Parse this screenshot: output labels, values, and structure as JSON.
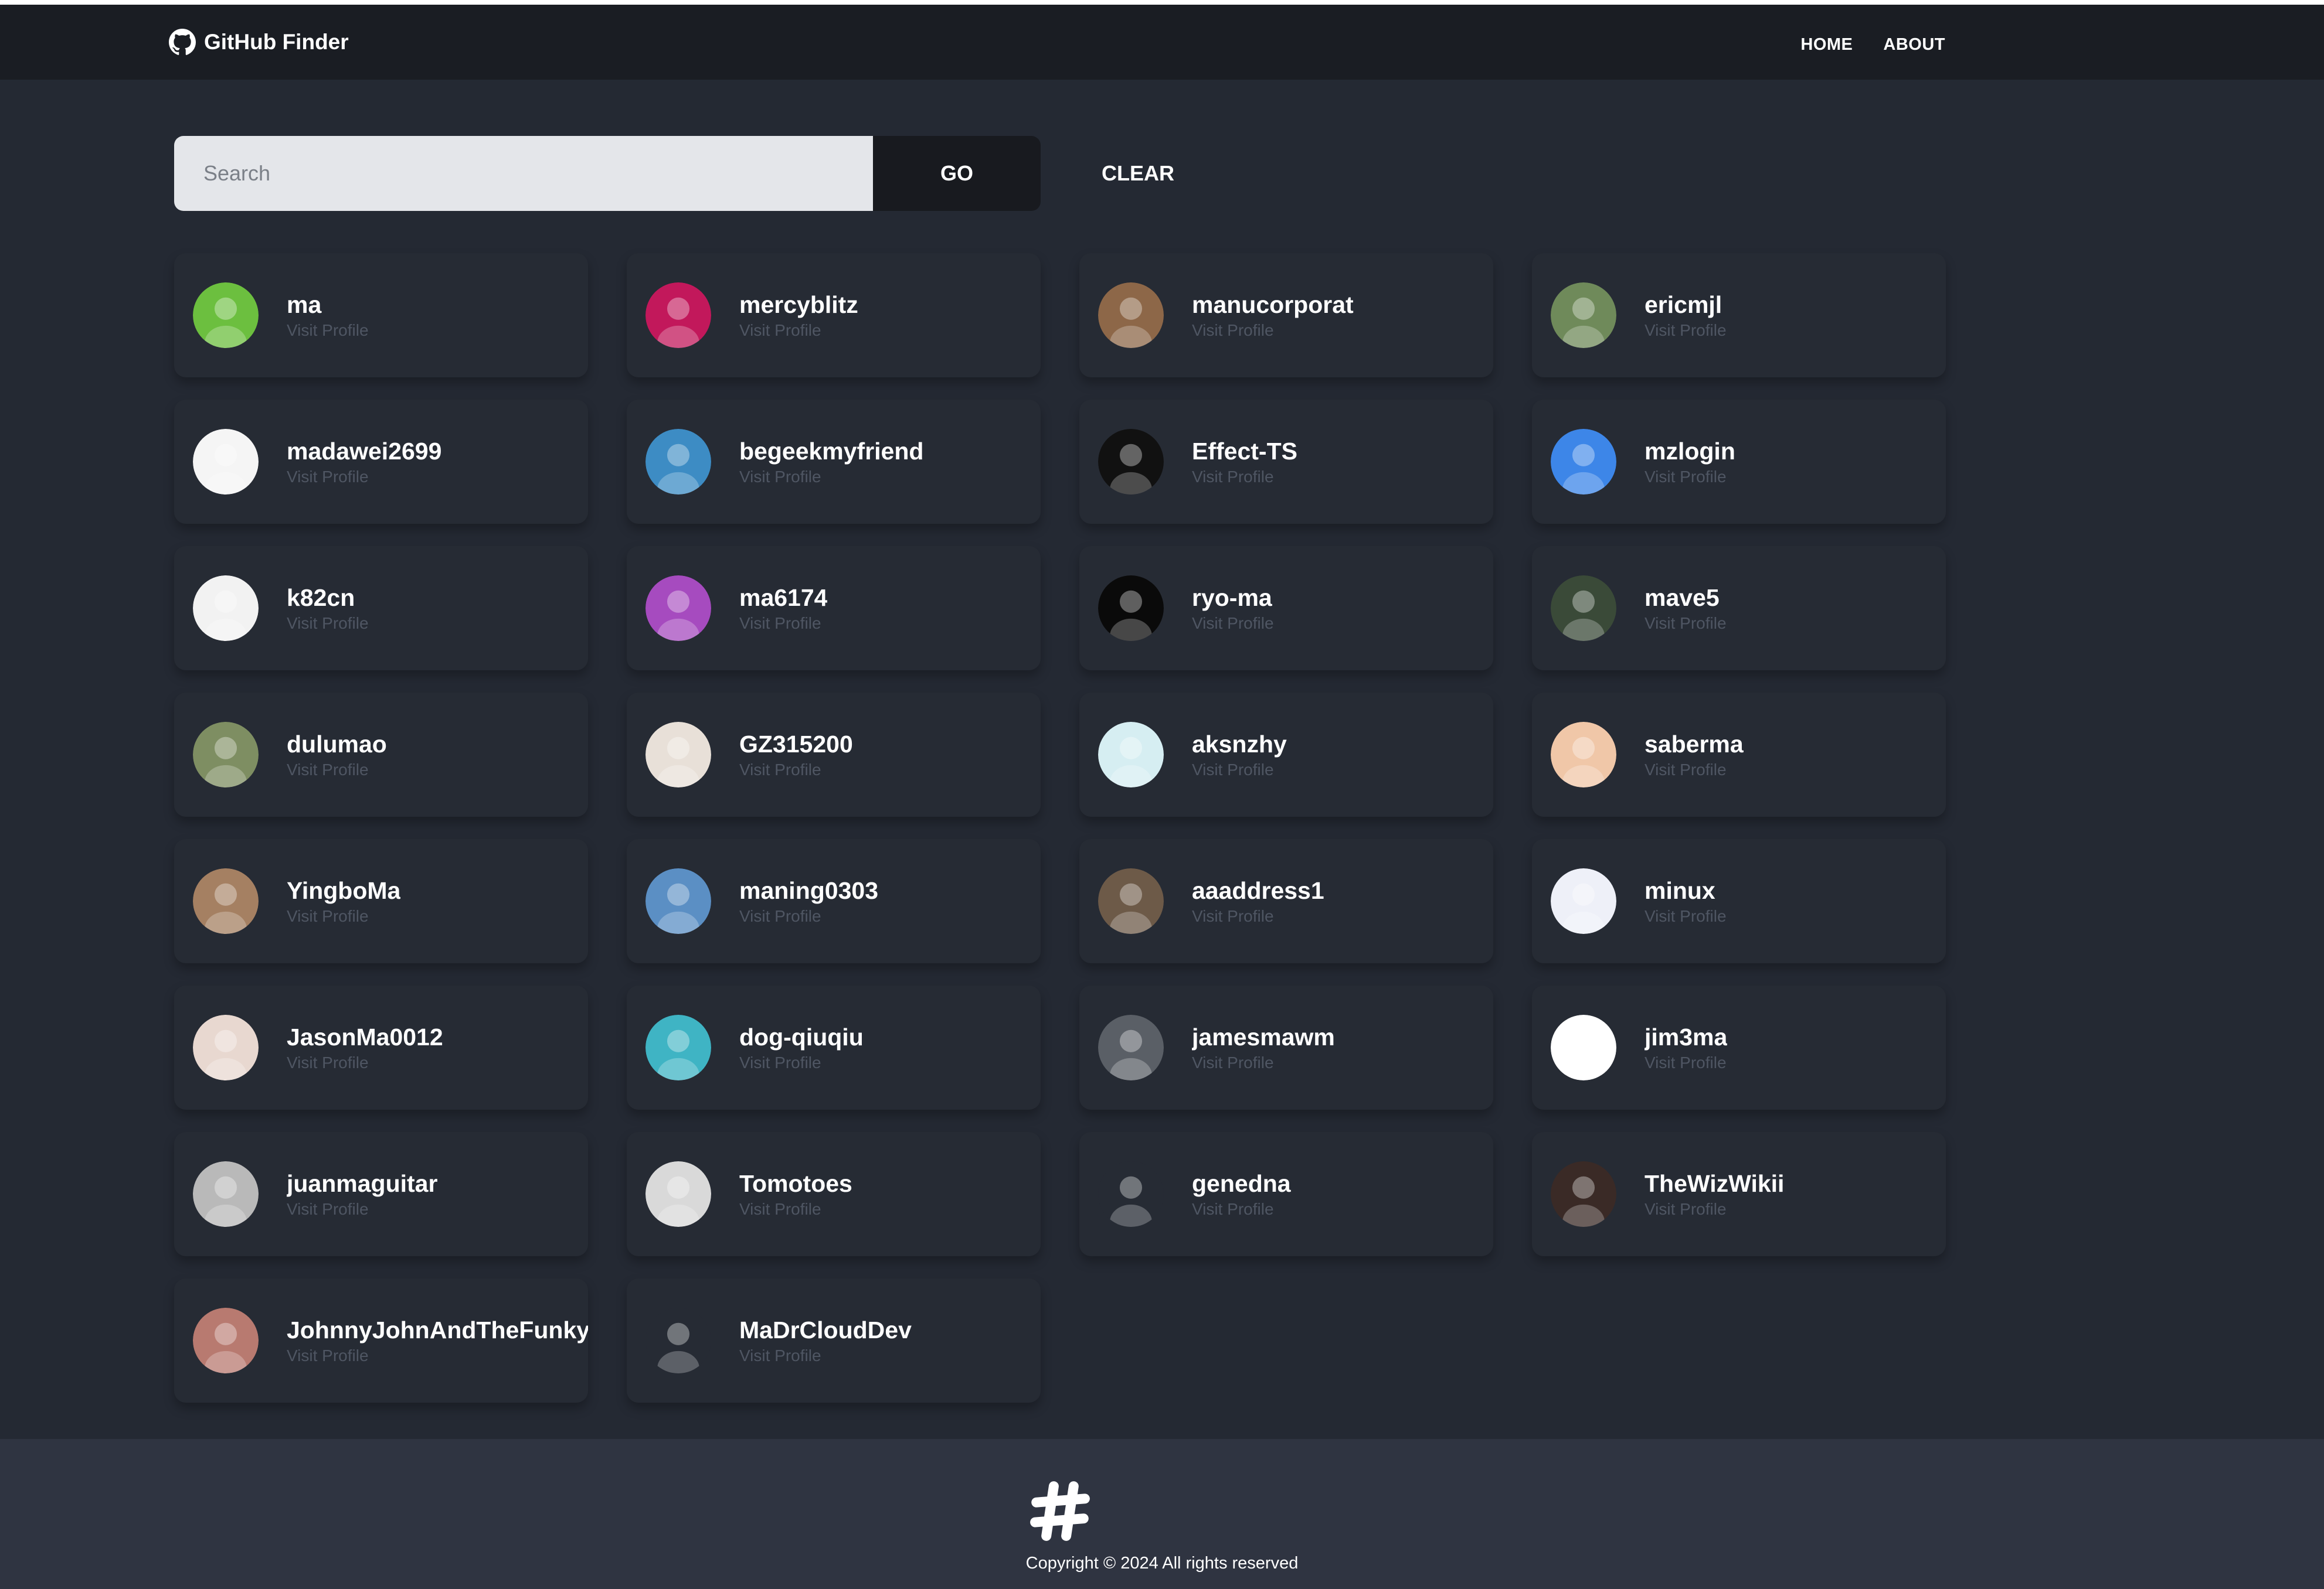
{
  "app": {
    "title": "GitHub Finder",
    "nav": [
      "HOME",
      "ABOUT"
    ]
  },
  "search": {
    "placeholder": "Search",
    "value": "",
    "go_label": "GO",
    "clear_label": "CLEAR"
  },
  "users": [
    {
      "login": "ma",
      "link": "Visit Profile",
      "avatar_color": "#6cbf3f"
    },
    {
      "login": "mercyblitz",
      "link": "Visit Profile",
      "avatar_color": "#c2185b"
    },
    {
      "login": "manucorporat",
      "link": "Visit Profile",
      "avatar_color": "#8d6748"
    },
    {
      "login": "ericmjl",
      "link": "Visit Profile",
      "avatar_color": "#6f8a5a"
    },
    {
      "login": "madawei2699",
      "link": "Visit Profile",
      "avatar_color": "#f5f5f5"
    },
    {
      "login": "begeekmyfriend",
      "link": "Visit Profile",
      "avatar_color": "#3d8cc4"
    },
    {
      "login": "Effect-TS",
      "link": "Visit Profile",
      "avatar_color": "#111111"
    },
    {
      "login": "mzlogin",
      "link": "Visit Profile",
      "avatar_color": "#3d86e8"
    },
    {
      "login": "k82cn",
      "link": "Visit Profile",
      "avatar_color": "#f2f2f2"
    },
    {
      "login": "ma6174",
      "link": "Visit Profile",
      "avatar_color": "#a64bbf"
    },
    {
      "login": "ryo-ma",
      "link": "Visit Profile",
      "avatar_color": "#0a0a0a"
    },
    {
      "login": "mave5",
      "link": "Visit Profile",
      "avatar_color": "#3a4a38"
    },
    {
      "login": "dulumao",
      "link": "Visit Profile",
      "avatar_color": "#7e8e62"
    },
    {
      "login": "GZ315200",
      "link": "Visit Profile",
      "avatar_color": "#e8e0d8"
    },
    {
      "login": "aksnzhy",
      "link": "Visit Profile",
      "avatar_color": "#d6eef2"
    },
    {
      "login": "saberma",
      "link": "Visit Profile",
      "avatar_color": "#f0c7a8"
    },
    {
      "login": "YingboMa",
      "link": "Visit Profile",
      "avatar_color": "#a58062"
    },
    {
      "login": "maning0303",
      "link": "Visit Profile",
      "avatar_color": "#5b8fc4"
    },
    {
      "login": "aaaddress1",
      "link": "Visit Profile",
      "avatar_color": "#6d5a48"
    },
    {
      "login": "minux",
      "link": "Visit Profile",
      "avatar_color": "#eef0f8"
    },
    {
      "login": "JasonMa0012",
      "link": "Visit Profile",
      "avatar_color": "#e8d8d0"
    },
    {
      "login": "dog-qiuqiu",
      "link": "Visit Profile",
      "avatar_color": "#3fb4c4"
    },
    {
      "login": "jamesmawm",
      "link": "Visit Profile",
      "avatar_color": "#5a5f66"
    },
    {
      "login": "jim3ma",
      "link": "Visit Profile",
      "avatar_color": "#ffffff"
    },
    {
      "login": "juanmaguitar",
      "link": "Visit Profile",
      "avatar_color": "#b9b9b9"
    },
    {
      "login": "Tomotoes",
      "link": "Visit Profile",
      "avatar_color": "#d9d9d9"
    },
    {
      "login": "genedna",
      "link": "Visit Profile",
      "avatar_color": "#262b34"
    },
    {
      "login": "TheWizWikii",
      "link": "Visit Profile",
      "avatar_color": "#3a2a26"
    },
    {
      "login": "JohnnyJohnAndTheFunkyBunch",
      "link": "Visit Profile",
      "avatar_color": "#b87a70"
    },
    {
      "login": "MaDrCloudDev",
      "link": "Visit Profile",
      "avatar_color": "#262b34"
    }
  ],
  "footer": {
    "copyright": "Copyright © 2024 All rights reserved"
  }
}
